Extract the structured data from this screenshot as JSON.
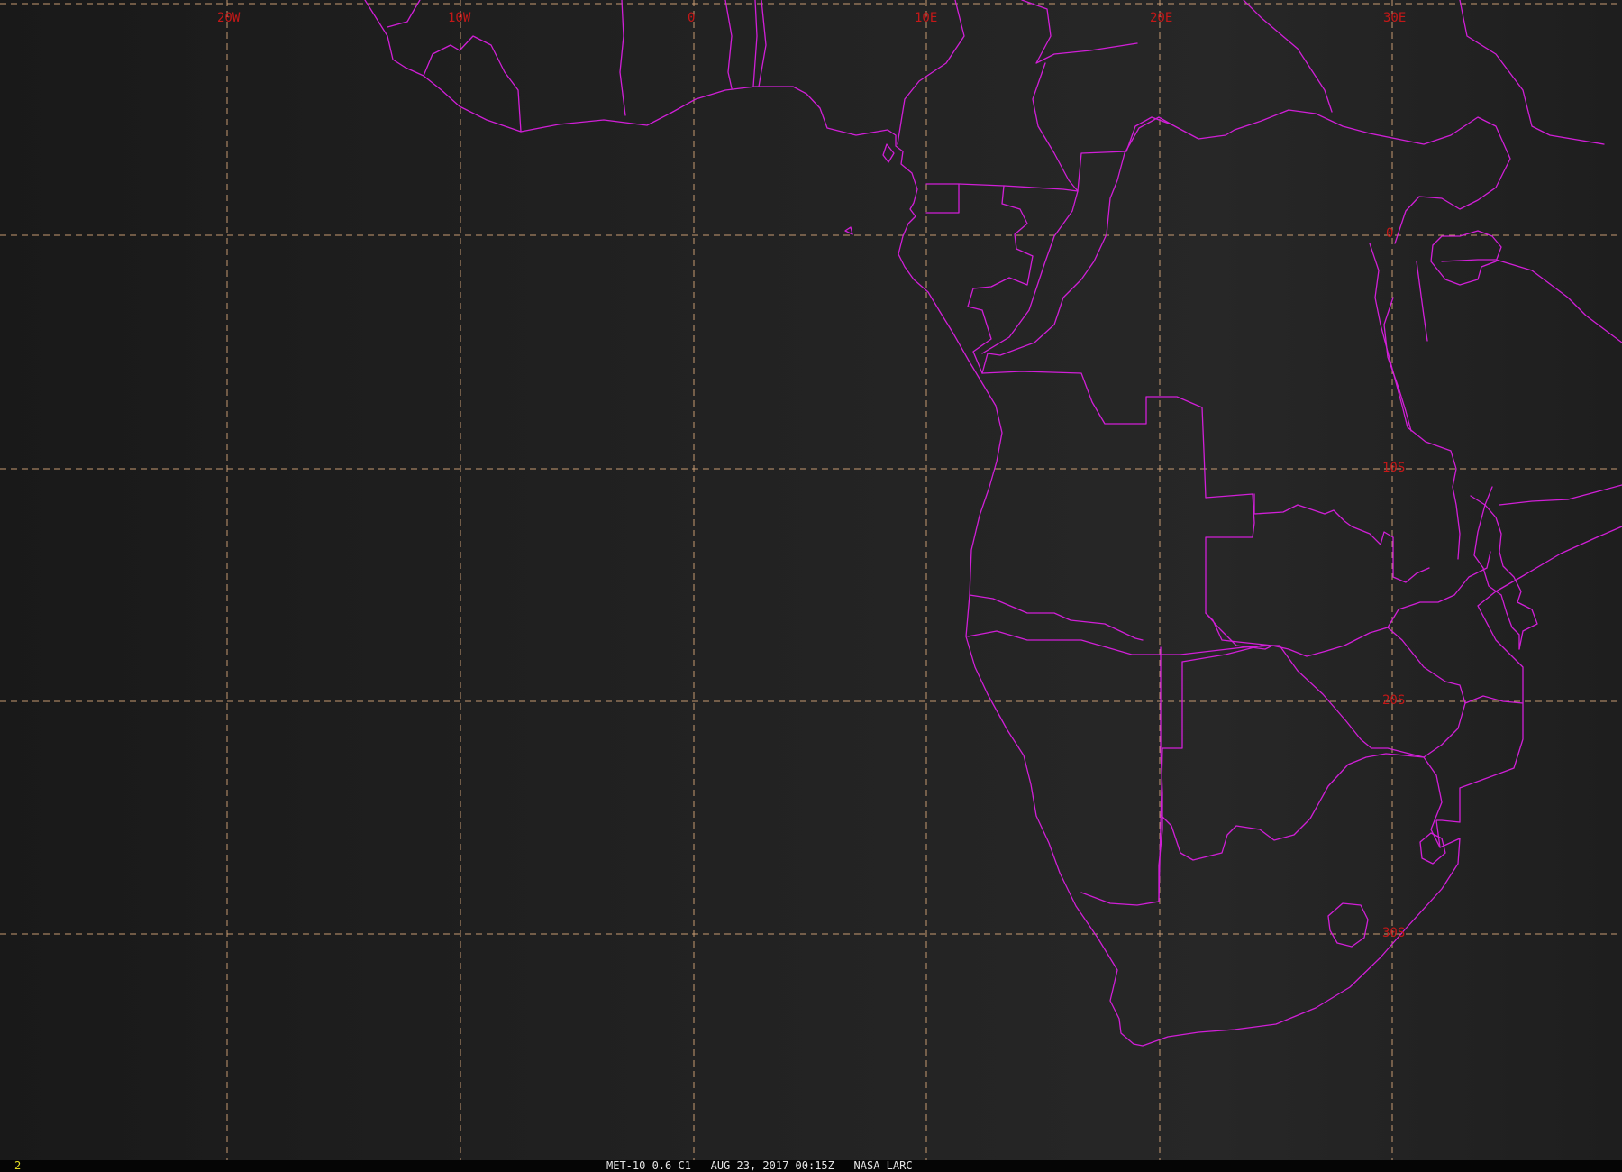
{
  "map": {
    "longitude_labels": [
      "20W",
      "10W",
      "0",
      "10E",
      "20E",
      "30E"
    ],
    "latitude_labels": [
      "0",
      "10S",
      "20S",
      "30S"
    ],
    "colors": {
      "grid": "#d8a77a",
      "coastline": "#d11fd7",
      "labels": "#c41818",
      "background": "#222222"
    }
  },
  "status": {
    "frame_number": "2",
    "title": "MET-10 0.6 C1   AUG 23, 2017 00:15Z   NASA LARC"
  }
}
